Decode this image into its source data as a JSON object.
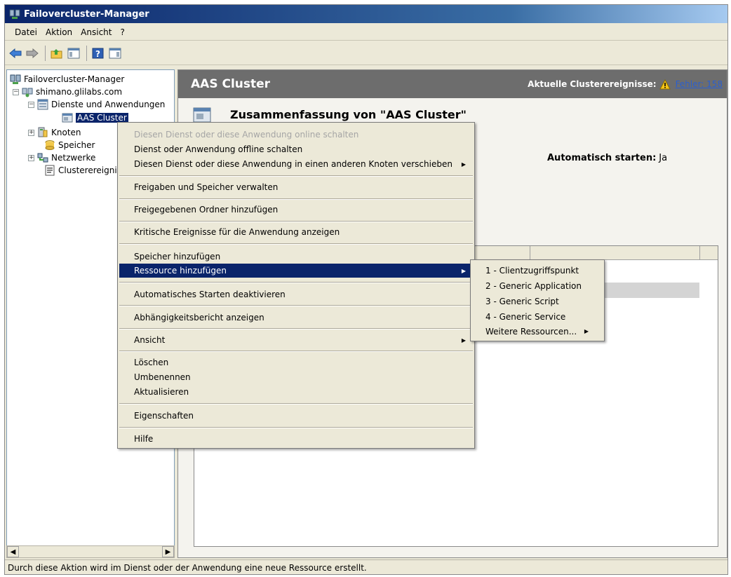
{
  "window": {
    "title": "Failovercluster-Manager"
  },
  "menubar": {
    "items": [
      "Datei",
      "Aktion",
      "Ansicht",
      "?"
    ]
  },
  "toolbar": {
    "buttons": [
      "back-icon",
      "forward-icon",
      "up-folder-icon",
      "console-tree-icon",
      "help-icon",
      "action-pane-icon"
    ]
  },
  "tree": {
    "root": "Failovercluster-Manager",
    "cluster": "shimano.glilabs.com",
    "services": "Dienste und Anwendungen",
    "selected": "AAS Cluster",
    "nodes": "Knoten",
    "storage": "Speicher",
    "networks": "Netzwerke",
    "events": "Clusterereignisse"
  },
  "content": {
    "title": "AAS Cluster",
    "events_label": "Aktuelle Clusterereignisse:",
    "events_link": "Fehler: 158",
    "summary_title": "Zusammenfassung von \"AAS Cluster\"",
    "auto_start_label": "Automatisch starten:",
    "auto_start_value": "Ja"
  },
  "context_menu": {
    "items": [
      "Diesen Dienst oder diese Anwendung online schalten",
      "Dienst oder Anwendung offline schalten",
      "Diesen Dienst oder diese Anwendung in einen anderen Knoten verschieben",
      "Freigaben und Speicher verwalten",
      "Freigegebenen Ordner hinzufügen",
      "Kritische Ereignisse für die Anwendung anzeigen",
      "Speicher hinzufügen",
      "Ressource hinzufügen",
      "Automatisches Starten deaktivieren",
      "Abhängigkeitsbericht anzeigen",
      "Ansicht",
      "Löschen",
      "Umbenennen",
      "Aktualisieren",
      "Eigenschaften",
      "Hilfe"
    ],
    "disabled_item": "Diesen Dienst oder diese Anwendung online schalten",
    "highlighted_item": "Ressource hinzufügen"
  },
  "submenu": {
    "items": [
      "1 - Clientzugriffspunkt",
      "2 - Generic Application",
      "3 - Generic Script",
      "4 - Generic Service",
      "Weitere Ressourcen..."
    ]
  },
  "statusbar": {
    "text": "Durch diese Aktion wird im Dienst oder der Anwendung eine neue Ressource erstellt."
  },
  "colors": {
    "titlebar": "#0a246a",
    "highlight": "#0a246a",
    "header": "#6d6d6d",
    "chrome": "#ece9d8",
    "link": "#2a5fd0"
  }
}
